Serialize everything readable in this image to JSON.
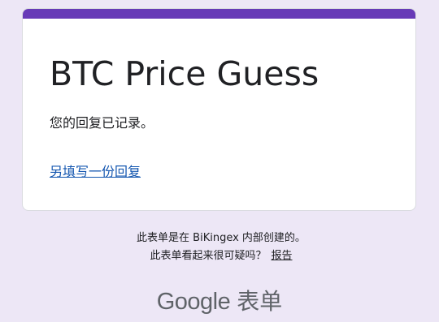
{
  "form": {
    "title": "BTC Price Guess",
    "confirmation": "您的回复已记录。",
    "another_response_link": "另填写一份回复"
  },
  "footer": {
    "created_in": "此表单是在 BiKingex 内部创建的。",
    "suspicious_question": "此表单看起来很可疑吗？",
    "report_link": "报告"
  },
  "branding": {
    "google": "Google",
    "product": "表单"
  },
  "colors": {
    "accent": "#673ab7",
    "background": "#ede7f6",
    "link": "#1557b0"
  }
}
